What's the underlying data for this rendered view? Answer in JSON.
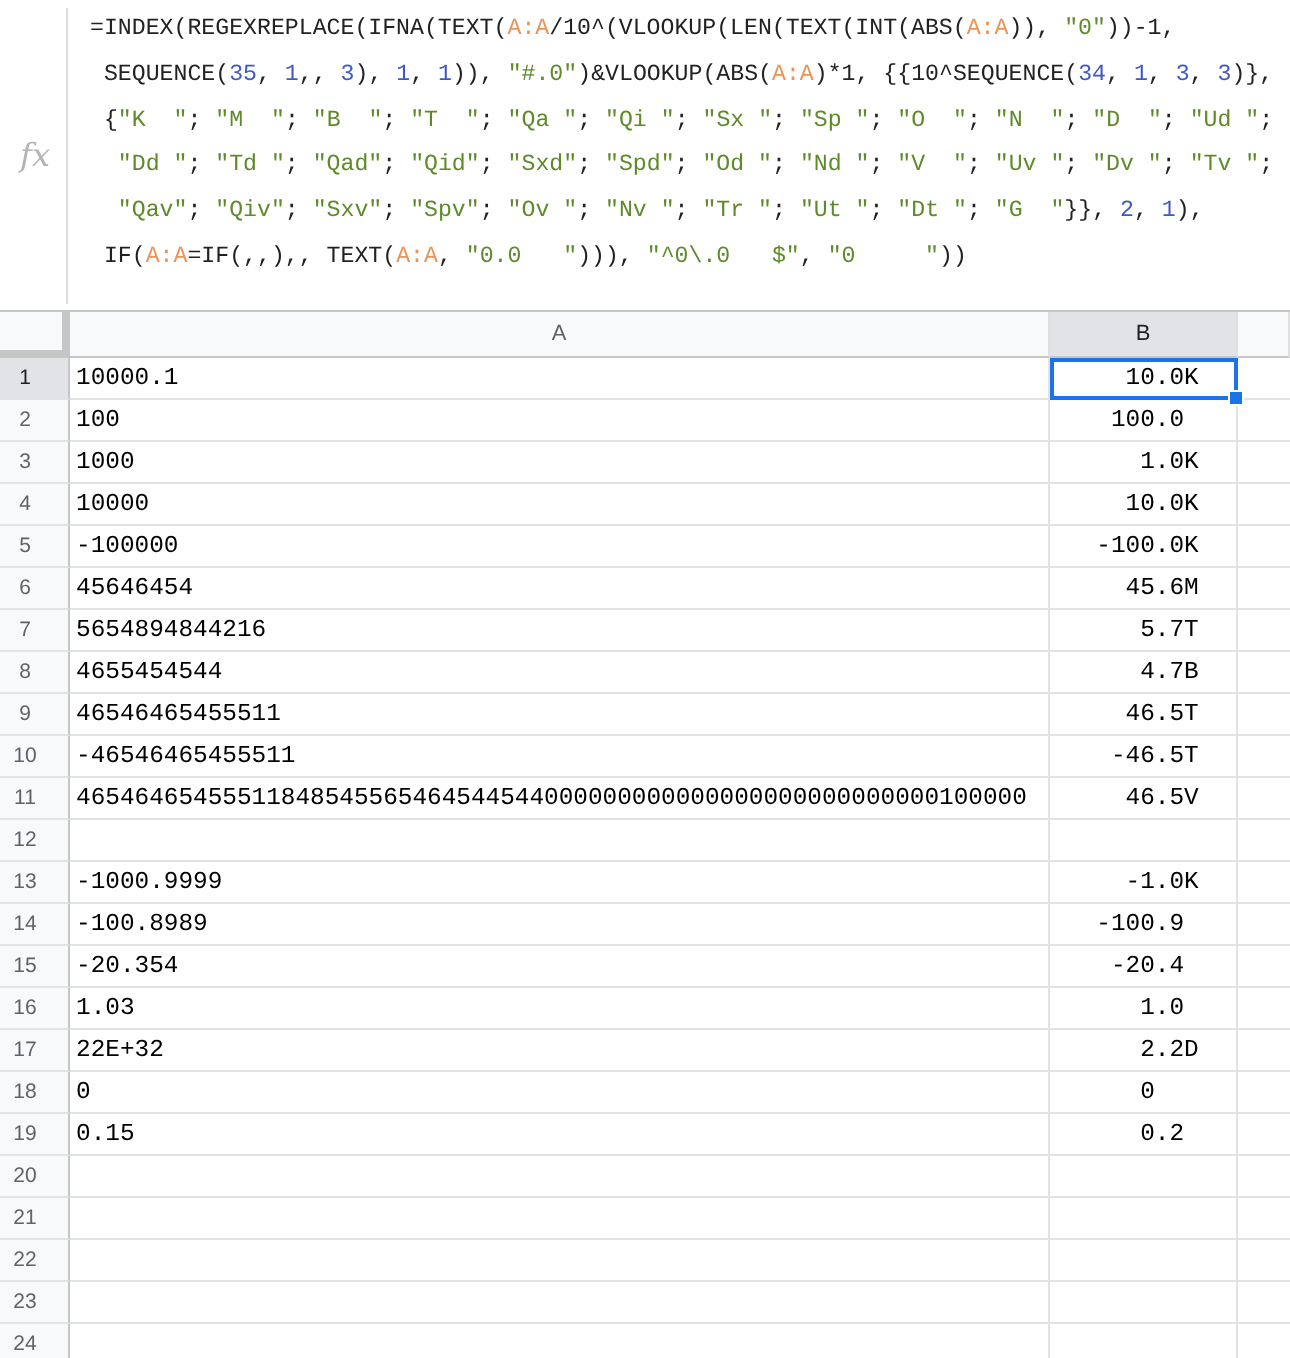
{
  "formula_bar": {
    "label": "fx",
    "lines": [
      [
        {
          "kind": "plain",
          "text": "=INDEX(REGEXREPLACE(IFNA(TEXT("
        },
        {
          "kind": "ref",
          "text": "A:A"
        },
        {
          "kind": "plain",
          "text": "/10^(VLOOKUP(LEN(TEXT(INT(ABS("
        },
        {
          "kind": "ref",
          "text": "A:A"
        },
        {
          "kind": "plain",
          "text": ")), "
        },
        {
          "kind": "string",
          "text": "\"0\""
        },
        {
          "kind": "plain",
          "text": "))-1,"
        }
      ],
      [
        {
          "kind": "plain",
          "text": " SEQUENCE("
        },
        {
          "kind": "number",
          "text": "35"
        },
        {
          "kind": "plain",
          "text": ", "
        },
        {
          "kind": "number",
          "text": "1"
        },
        {
          "kind": "plain",
          "text": ",, "
        },
        {
          "kind": "number",
          "text": "3"
        },
        {
          "kind": "plain",
          "text": "), "
        },
        {
          "kind": "number",
          "text": "1"
        },
        {
          "kind": "plain",
          "text": ", "
        },
        {
          "kind": "number",
          "text": "1"
        },
        {
          "kind": "plain",
          "text": ")), "
        },
        {
          "kind": "string",
          "text": "\"#.0\""
        },
        {
          "kind": "plain",
          "text": ")&VLOOKUP(ABS("
        },
        {
          "kind": "ref",
          "text": "A:A"
        },
        {
          "kind": "plain",
          "text": ")*1, {{10^SEQUENCE("
        },
        {
          "kind": "number",
          "text": "34"
        },
        {
          "kind": "plain",
          "text": ", "
        },
        {
          "kind": "number",
          "text": "1"
        },
        {
          "kind": "plain",
          "text": ", "
        },
        {
          "kind": "number",
          "text": "3"
        },
        {
          "kind": "plain",
          "text": ", "
        },
        {
          "kind": "number",
          "text": "3"
        },
        {
          "kind": "plain",
          "text": ")},"
        }
      ],
      [
        {
          "kind": "plain",
          "text": " {"
        },
        {
          "kind": "string",
          "text": "\"K  \""
        },
        {
          "kind": "plain",
          "text": "; "
        },
        {
          "kind": "string",
          "text": "\"M  \""
        },
        {
          "kind": "plain",
          "text": "; "
        },
        {
          "kind": "string",
          "text": "\"B  \""
        },
        {
          "kind": "plain",
          "text": "; "
        },
        {
          "kind": "string",
          "text": "\"T  \""
        },
        {
          "kind": "plain",
          "text": "; "
        },
        {
          "kind": "string",
          "text": "\"Qa \""
        },
        {
          "kind": "plain",
          "text": "; "
        },
        {
          "kind": "string",
          "text": "\"Qi \""
        },
        {
          "kind": "plain",
          "text": "; "
        },
        {
          "kind": "string",
          "text": "\"Sx \""
        },
        {
          "kind": "plain",
          "text": "; "
        },
        {
          "kind": "string",
          "text": "\"Sp \""
        },
        {
          "kind": "plain",
          "text": "; "
        },
        {
          "kind": "string",
          "text": "\"O  \""
        },
        {
          "kind": "plain",
          "text": "; "
        },
        {
          "kind": "string",
          "text": "\"N  \""
        },
        {
          "kind": "plain",
          "text": "; "
        },
        {
          "kind": "string",
          "text": "\"D  \""
        },
        {
          "kind": "plain",
          "text": "; "
        },
        {
          "kind": "string",
          "text": "\"Ud \""
        },
        {
          "kind": "plain",
          "text": ";"
        }
      ],
      [
        {
          "kind": "string",
          "text": "  \"Dd \""
        },
        {
          "kind": "plain",
          "text": "; "
        },
        {
          "kind": "string",
          "text": "\"Td \""
        },
        {
          "kind": "plain",
          "text": "; "
        },
        {
          "kind": "string",
          "text": "\"Qad\""
        },
        {
          "kind": "plain",
          "text": "; "
        },
        {
          "kind": "string",
          "text": "\"Qid\""
        },
        {
          "kind": "plain",
          "text": "; "
        },
        {
          "kind": "string",
          "text": "\"Sxd\""
        },
        {
          "kind": "plain",
          "text": "; "
        },
        {
          "kind": "string",
          "text": "\"Spd\""
        },
        {
          "kind": "plain",
          "text": "; "
        },
        {
          "kind": "string",
          "text": "\"Od \""
        },
        {
          "kind": "plain",
          "text": "; "
        },
        {
          "kind": "string",
          "text": "\"Nd \""
        },
        {
          "kind": "plain",
          "text": "; "
        },
        {
          "kind": "string",
          "text": "\"V  \""
        },
        {
          "kind": "plain",
          "text": "; "
        },
        {
          "kind": "string",
          "text": "\"Uv \""
        },
        {
          "kind": "plain",
          "text": "; "
        },
        {
          "kind": "string",
          "text": "\"Dv \""
        },
        {
          "kind": "plain",
          "text": "; "
        },
        {
          "kind": "string",
          "text": "\"Tv \""
        },
        {
          "kind": "plain",
          "text": ";"
        }
      ],
      [
        {
          "kind": "string",
          "text": "  \"Qav\""
        },
        {
          "kind": "plain",
          "text": "; "
        },
        {
          "kind": "string",
          "text": "\"Qiv\""
        },
        {
          "kind": "plain",
          "text": "; "
        },
        {
          "kind": "string",
          "text": "\"Sxv\""
        },
        {
          "kind": "plain",
          "text": "; "
        },
        {
          "kind": "string",
          "text": "\"Spv\""
        },
        {
          "kind": "plain",
          "text": "; "
        },
        {
          "kind": "string",
          "text": "\"Ov \""
        },
        {
          "kind": "plain",
          "text": "; "
        },
        {
          "kind": "string",
          "text": "\"Nv \""
        },
        {
          "kind": "plain",
          "text": "; "
        },
        {
          "kind": "string",
          "text": "\"Tr \""
        },
        {
          "kind": "plain",
          "text": "; "
        },
        {
          "kind": "string",
          "text": "\"Ut \""
        },
        {
          "kind": "plain",
          "text": "; "
        },
        {
          "kind": "string",
          "text": "\"Dt \""
        },
        {
          "kind": "plain",
          "text": "; "
        },
        {
          "kind": "string",
          "text": "\"G  \""
        },
        {
          "kind": "plain",
          "text": "}}, "
        },
        {
          "kind": "number",
          "text": "2"
        },
        {
          "kind": "plain",
          "text": ", "
        },
        {
          "kind": "number",
          "text": "1"
        },
        {
          "kind": "plain",
          "text": "),"
        }
      ],
      [
        {
          "kind": "plain",
          "text": " IF("
        },
        {
          "kind": "ref",
          "text": "A:A"
        },
        {
          "kind": "plain",
          "text": "=IF(,,),, TEXT("
        },
        {
          "kind": "ref",
          "text": "A:A"
        },
        {
          "kind": "plain",
          "text": ", "
        },
        {
          "kind": "string",
          "text": "\"0.0   \""
        },
        {
          "kind": "plain",
          "text": "))), "
        },
        {
          "kind": "string",
          "text": "\"^0\\.0   $\""
        },
        {
          "kind": "plain",
          "text": ", "
        },
        {
          "kind": "string",
          "text": "\"0     \""
        },
        {
          "kind": "plain",
          "text": "))"
        }
      ]
    ]
  },
  "sheet": {
    "columns": [
      {
        "label": "A",
        "selected": false
      },
      {
        "label": "B",
        "selected": true
      }
    ],
    "rows": [
      {
        "number": "1",
        "selected": true,
        "cells": [
          "10000.1",
          "10.0K  "
        ]
      },
      {
        "number": "2",
        "selected": false,
        "cells": [
          "100",
          "100.0   "
        ]
      },
      {
        "number": "3",
        "selected": false,
        "cells": [
          "1000",
          "1.0K  "
        ]
      },
      {
        "number": "4",
        "selected": false,
        "cells": [
          "10000",
          "10.0K  "
        ]
      },
      {
        "number": "5",
        "selected": false,
        "cells": [
          "-100000",
          "-100.0K  "
        ]
      },
      {
        "number": "6",
        "selected": false,
        "cells": [
          "45646454",
          "45.6M  "
        ]
      },
      {
        "number": "7",
        "selected": false,
        "cells": [
          "5654894844216",
          "5.7T  "
        ]
      },
      {
        "number": "8",
        "selected": false,
        "cells": [
          "4655454544",
          "4.7B  "
        ]
      },
      {
        "number": "9",
        "selected": false,
        "cells": [
          "46546465455511",
          "46.5T  "
        ]
      },
      {
        "number": "10",
        "selected": false,
        "cells": [
          "-46546465455511",
          "-46.5T  "
        ]
      },
      {
        "number": "11",
        "selected": false,
        "cells": [
          "46546465455511848545565464544544000000000000000000000000000100000",
          "46.5V  "
        ]
      },
      {
        "number": "12",
        "selected": false
      },
      {
        "number": "13",
        "selected": false,
        "cells": [
          "-1000.9999",
          "-1.0K  "
        ]
      },
      {
        "number": "14",
        "selected": false,
        "cells": [
          "-100.8989",
          "-100.9   "
        ]
      },
      {
        "number": "15",
        "selected": false,
        "cells": [
          "-20.354",
          "-20.4   "
        ]
      },
      {
        "number": "16",
        "selected": false,
        "cells": [
          "1.03",
          "1.0   "
        ]
      },
      {
        "number": "17",
        "selected": false,
        "cells": [
          "22E+32",
          "2.2D  "
        ]
      },
      {
        "number": "18",
        "selected": false,
        "cells": [
          "0",
          "0     "
        ]
      },
      {
        "number": "19",
        "selected": false,
        "cells": [
          "0.15",
          "0.2   "
        ]
      },
      {
        "number": "20",
        "selected": false
      },
      {
        "number": "21",
        "selected": false
      },
      {
        "number": "22",
        "selected": false
      },
      {
        "number": "23",
        "selected": false
      },
      {
        "number": "24",
        "selected": false
      }
    ]
  }
}
